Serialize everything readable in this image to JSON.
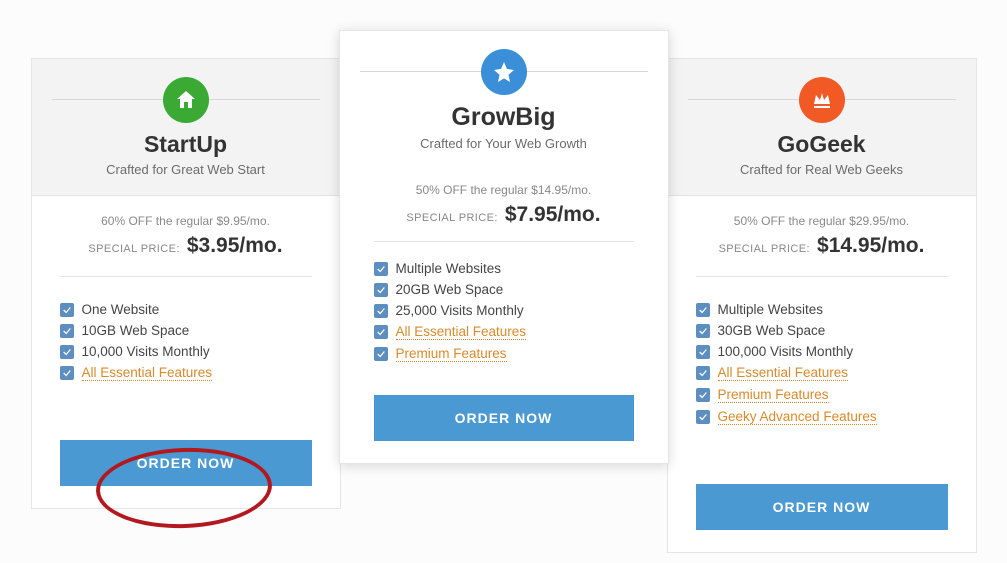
{
  "order_label": "ORDER NOW",
  "special_label": "SPECIAL PRICE:",
  "plans": [
    {
      "name": "StartUp",
      "subtitle": "Crafted for Great Web Start",
      "discount_line": "60% OFF the regular $9.95/mo.",
      "price": "$3.95/mo.",
      "features": [
        {
          "text": "One Website",
          "link": false
        },
        {
          "text": "10GB Web Space",
          "link": false
        },
        {
          "text": "10,000 Visits Monthly",
          "link": false
        },
        {
          "text": "All Essential Features",
          "link": true
        }
      ]
    },
    {
      "name": "GrowBig",
      "subtitle": "Crafted for Your Web Growth",
      "discount_line": "50% OFF the regular $14.95/mo.",
      "price": "$7.95/mo.",
      "features": [
        {
          "text": "Multiple Websites",
          "link": false
        },
        {
          "text": "20GB Web Space",
          "link": false
        },
        {
          "text": "25,000 Visits Monthly",
          "link": false
        },
        {
          "text": "All Essential Features",
          "link": true
        },
        {
          "text": "Premium Features",
          "link": true
        }
      ]
    },
    {
      "name": "GoGeek",
      "subtitle": "Crafted for Real Web Geeks",
      "discount_line": "50% OFF the regular $29.95/mo.",
      "price": "$14.95/mo.",
      "features": [
        {
          "text": "Multiple Websites",
          "link": false
        },
        {
          "text": "30GB Web Space",
          "link": false
        },
        {
          "text": "100,000 Visits Monthly",
          "link": false
        },
        {
          "text": "All Essential Features",
          "link": true
        },
        {
          "text": "Premium Features",
          "link": true
        },
        {
          "text": "Geeky Advanced Features",
          "link": true
        }
      ]
    }
  ],
  "annotation": {
    "type": "highlight-ellipse",
    "target": "order-button-startup",
    "color": "#b3181f"
  }
}
